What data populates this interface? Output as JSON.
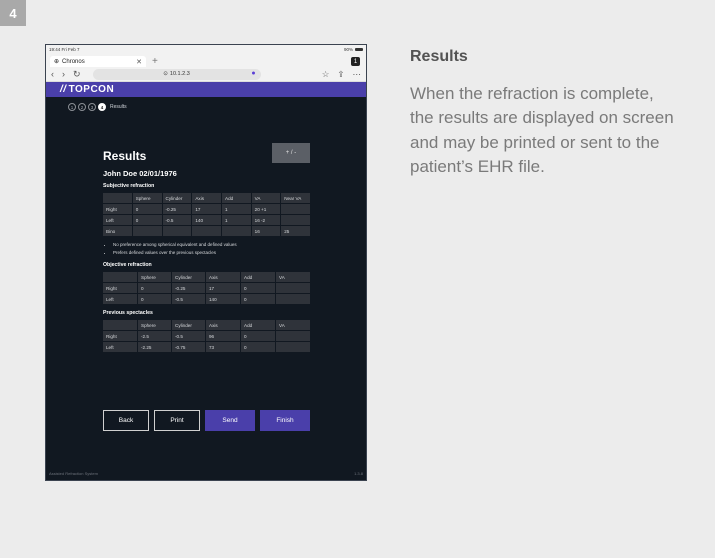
{
  "step_number": "4",
  "description": {
    "title": "Results",
    "body": "When the refraction is complete, the results are displayed on screen and may be printed or sent to the patient’s EHR file."
  },
  "tablet": {
    "status": {
      "time": "19:44  Fri Feb 7",
      "battery": "90%"
    },
    "browser_tab": {
      "label": "Chronos",
      "tab_count": "1"
    },
    "url": "10.1.2.3",
    "brand": "TOPCON",
    "stepper": {
      "steps": [
        "1",
        "2",
        "3",
        "4"
      ],
      "active_label": "Results"
    },
    "title": "Results",
    "toggle_label": "+ / -",
    "patient": "John Doe 02/01/1976",
    "subjective": {
      "label": "Subjective refraction",
      "headers": [
        "",
        "Sphere",
        "Cylinder",
        "Axis",
        "Add",
        "VA",
        "Near VA"
      ],
      "rows": [
        [
          "Right",
          "0",
          "-0.25",
          "17",
          "1",
          "20 +1",
          ""
        ],
        [
          "Left",
          "0",
          "-0.5",
          "140",
          "1",
          "16 -2",
          ""
        ],
        [
          "Bino",
          "",
          "",
          "",
          "",
          "16",
          "25"
        ]
      ]
    },
    "notes": [
      "No preference among spherical equivalent and defined values",
      "Prefers defined values over the previous spectacles"
    ],
    "objective": {
      "label": "Objective refraction",
      "headers": [
        "",
        "Sphere",
        "Cylinder",
        "Axis",
        "Add",
        "VA"
      ],
      "rows": [
        [
          "Right",
          "0",
          "-0.25",
          "17",
          "0",
          ""
        ],
        [
          "Left",
          "0",
          "-0.5",
          "140",
          "0",
          ""
        ]
      ]
    },
    "previous": {
      "label": "Previous spectacles",
      "headers": [
        "",
        "Sphere",
        "Cylinder",
        "Axis",
        "Add",
        "VA"
      ],
      "rows": [
        [
          "Right",
          "-2.5",
          "-0.5",
          "96",
          "0",
          ""
        ],
        [
          "Left",
          "-2.25",
          "-0.75",
          "73",
          "0",
          ""
        ]
      ]
    },
    "buttons": {
      "back": "Back",
      "print": "Print",
      "send": "Send",
      "finish": "Finish"
    },
    "footer": {
      "app_name": "Assisted Refraction System",
      "version": "1.3.8"
    },
    "colors": {
      "brand": "#4a3faa",
      "background": "#111821",
      "cell": "#2f333a"
    }
  }
}
